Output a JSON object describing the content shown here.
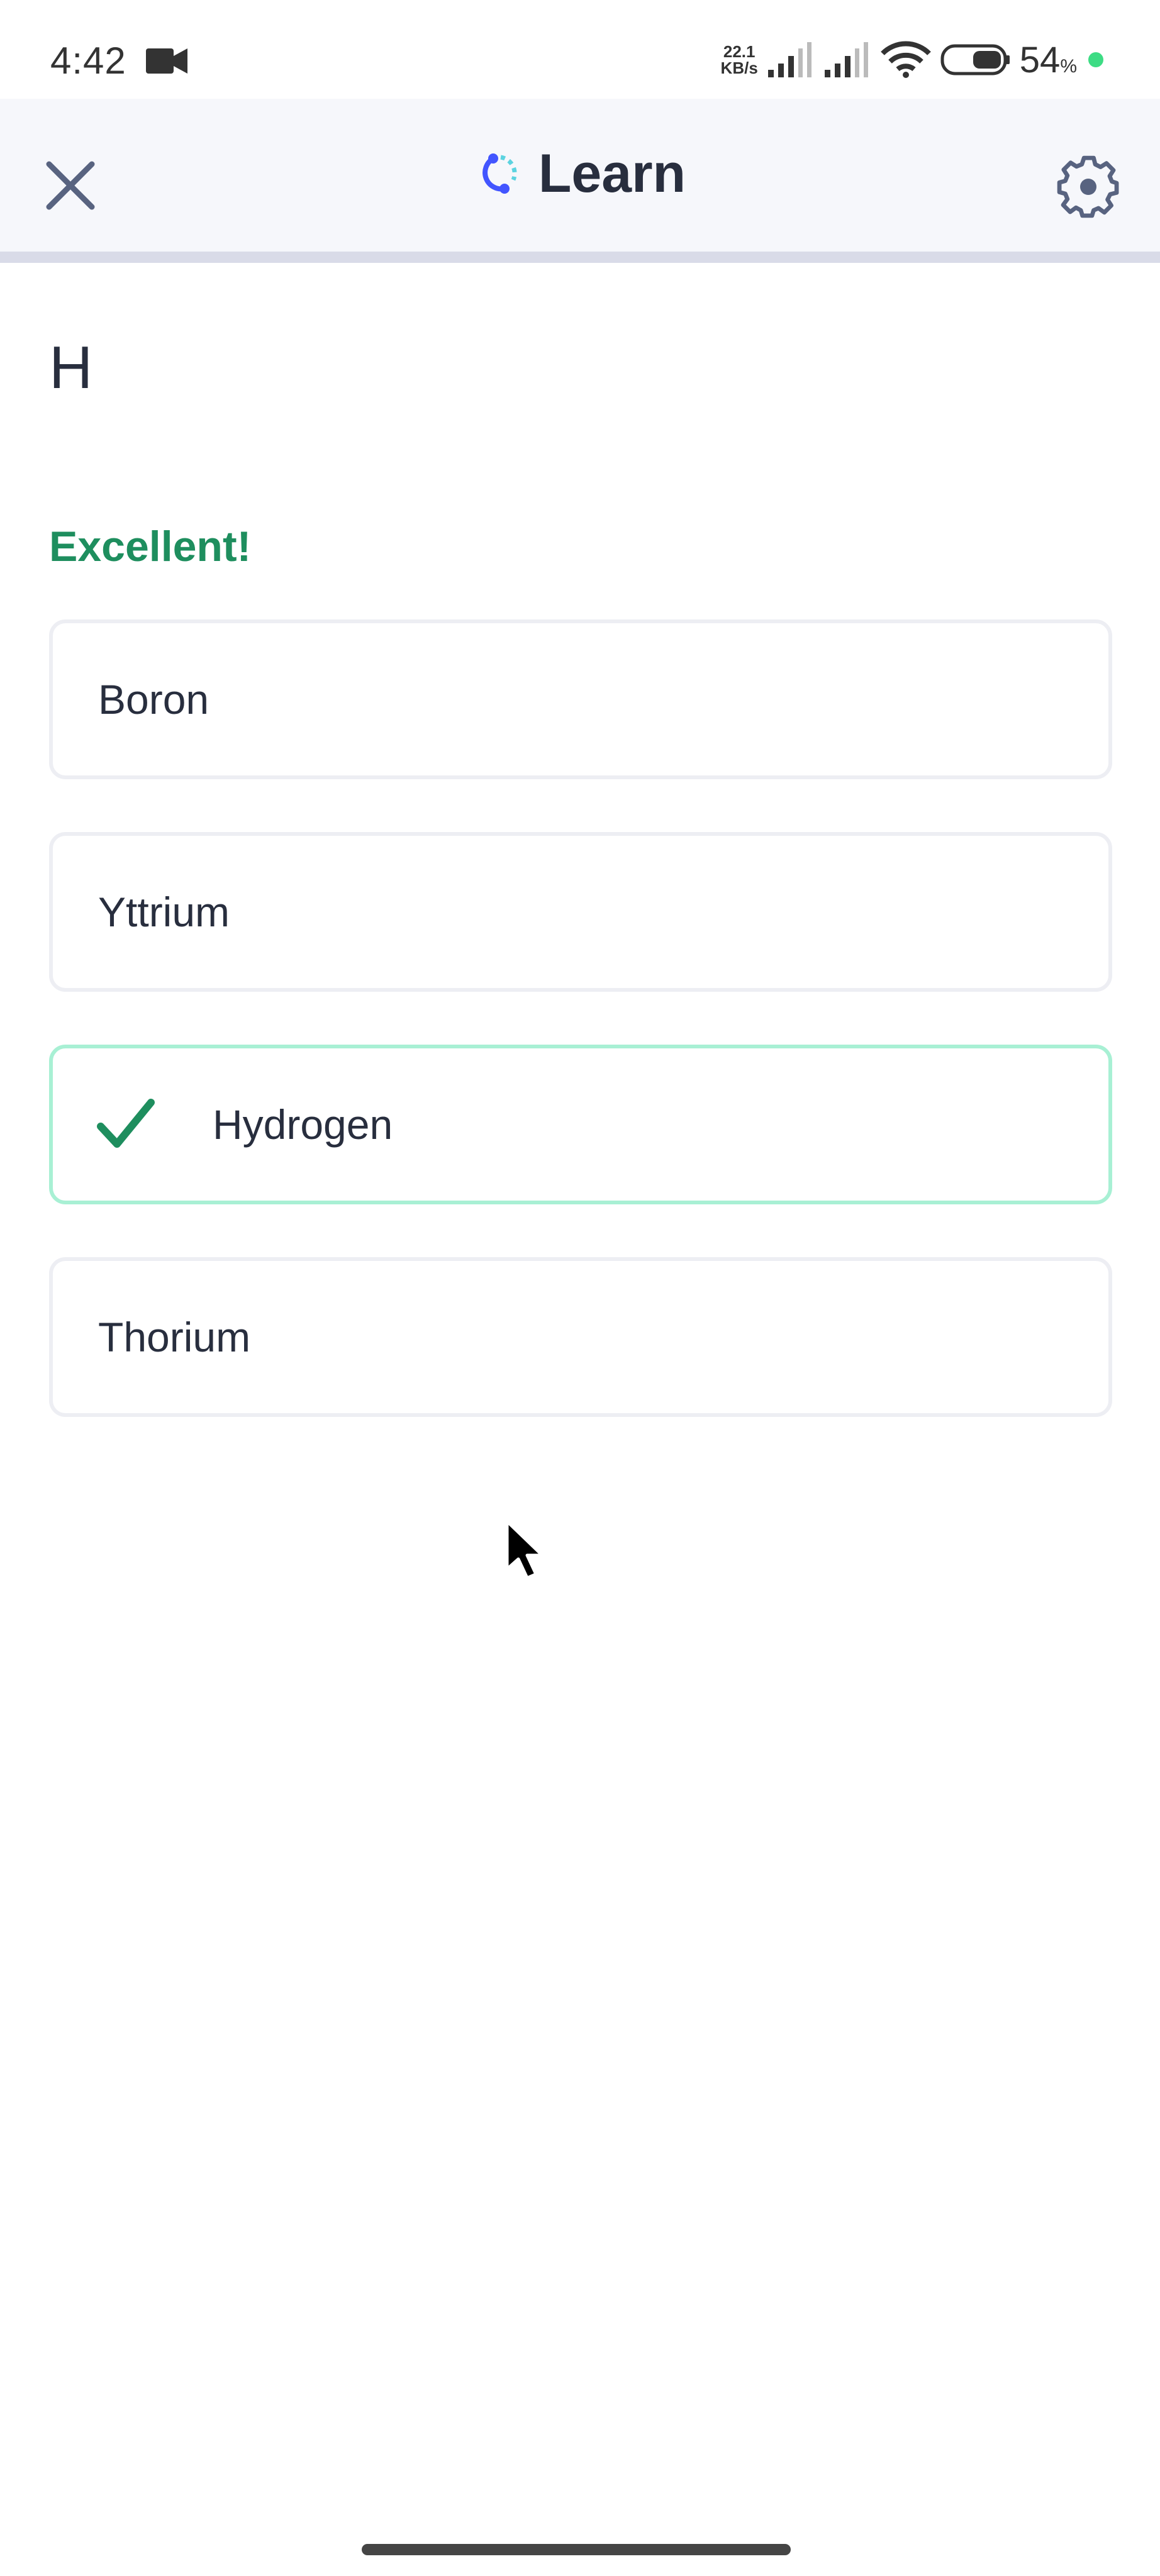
{
  "status_bar": {
    "time": "4:42",
    "network_speed_value": "22.1",
    "network_speed_unit": "KB/s",
    "battery_percent": "54",
    "battery_unit": "%",
    "icons": [
      "video-camera-icon",
      "cell-signal-icon",
      "cell-signal-icon",
      "wifi-icon",
      "battery-icon"
    ]
  },
  "header": {
    "title": "Learn",
    "close_icon": "close-icon",
    "settings_icon": "gear-icon",
    "logo_icon": "learn-logo-icon",
    "progress_fraction": 0
  },
  "question": {
    "prompt": "H",
    "feedback": "Excellent!"
  },
  "options": [
    {
      "label": "Boron",
      "state": "default"
    },
    {
      "label": "Yttrium",
      "state": "default"
    },
    {
      "label": "Hydrogen",
      "state": "correct"
    },
    {
      "label": "Thorium",
      "state": "default"
    }
  ],
  "colors": {
    "correct_green": "#1E8E5E",
    "correct_border": "#A8F0D4",
    "header_bg": "#F6F7FB",
    "brand_blue": "#4255FF",
    "brand_cyan": "#5CD3E0",
    "text_dark": "#282E3E"
  }
}
